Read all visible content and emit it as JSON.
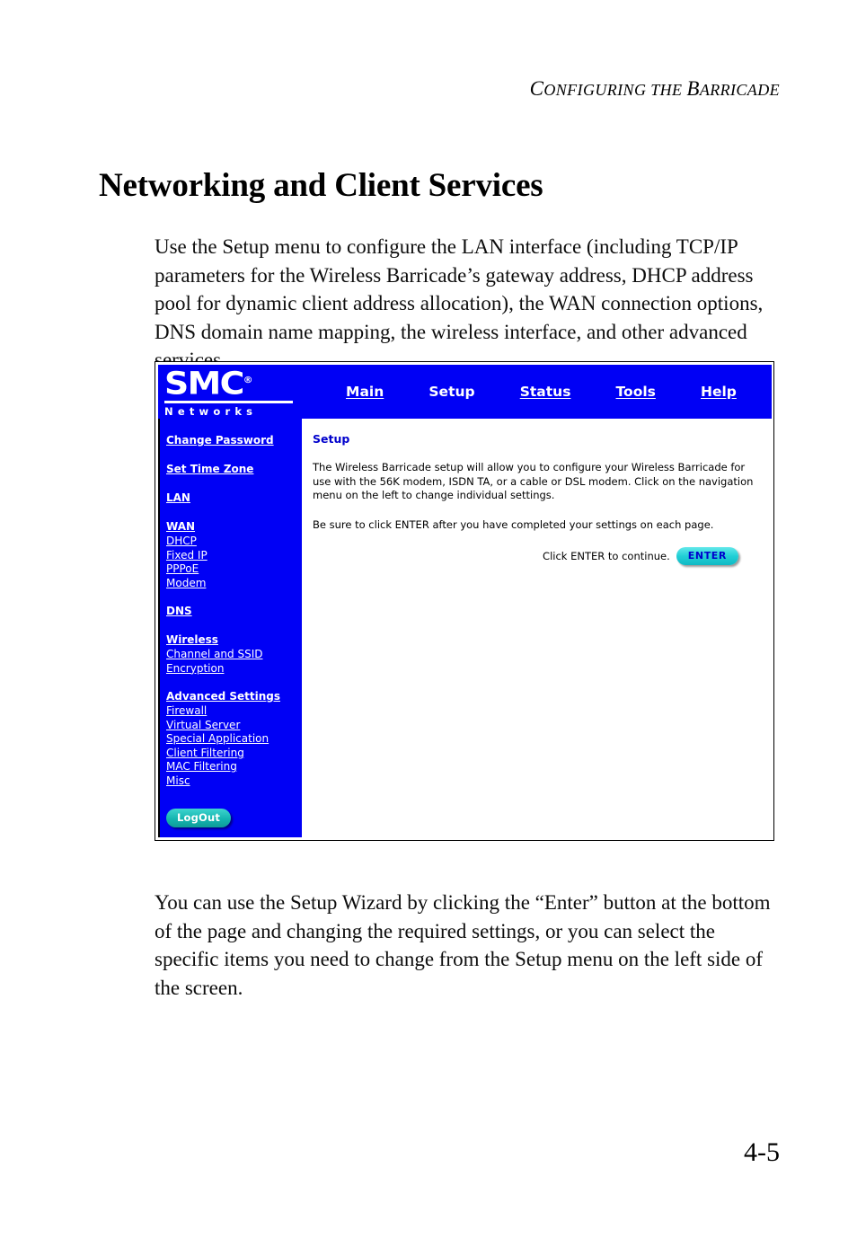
{
  "document": {
    "running_head_first": "C",
    "running_head_rest_1": "onfiguring the ",
    "running_head_b": "B",
    "running_head_rest_2": "arricade",
    "running_head_full": "CONFIGURING THE BARRICADE",
    "title": "Networking and Client Services",
    "intro_paragraph": "Use the Setup menu to configure the LAN interface (including TCP/IP parameters for the Wireless Barricade’s gateway address, DHCP address pool for dynamic client address allocation), the WAN connection options, DNS domain name mapping, the wireless interface, and other advanced services.",
    "outro_paragraph": "You can use the Setup Wizard by clicking the “Enter” button at the bottom of the page and changing the required settings, or you can select the specific items you need to change from the Setup menu on the left side of the screen.",
    "page_number": "4-5"
  },
  "screenshot": {
    "logo": {
      "brand": "SMC",
      "registered_mark": "®",
      "tagline": "Networks"
    },
    "nav": {
      "items": [
        {
          "label": "Main",
          "active": false
        },
        {
          "label": "Setup",
          "active": true
        },
        {
          "label": "Status",
          "active": false
        },
        {
          "label": "Tools",
          "active": false
        },
        {
          "label": "Help",
          "active": false
        }
      ]
    },
    "sidebar": {
      "groups": [
        {
          "head": "Change  Password",
          "subs": []
        },
        {
          "head": "Set Time Zone",
          "subs": []
        },
        {
          "head": "LAN",
          "subs": []
        },
        {
          "head": "WAN",
          "subs": [
            "DHCP",
            "Fixed IP",
            "PPPoE",
            "Modem"
          ]
        },
        {
          "head": "DNS",
          "subs": []
        },
        {
          "head": "Wireless",
          "subs": [
            "Channel and SSID",
            "Encryption"
          ]
        },
        {
          "head": "Advanced Settings",
          "subs": [
            "Firewall",
            "Virtual Server",
            "Special Application",
            "Client Filtering",
            "MAC Filtering",
            "Misc"
          ]
        }
      ],
      "logout_label": "LogOut"
    },
    "content": {
      "title": "Setup",
      "paragraph_1": "The Wireless Barricade setup will allow you to configure your Wireless Barricade for use with the 56K modem, ISDN TA, or a cable or DSL modem. Click on the navigation menu on the left to change individual settings.",
      "paragraph_2": "Be sure to click ENTER after you have completed your settings on each page.",
      "enter_prompt": "Click ENTER to continue.",
      "enter_button_label": "ENTER"
    },
    "colors": {
      "nav_blue": "#0000f5",
      "heading_blue": "#0000cc",
      "button_teal": "#14b5b0",
      "button_cyan": "#22cfd6"
    }
  }
}
